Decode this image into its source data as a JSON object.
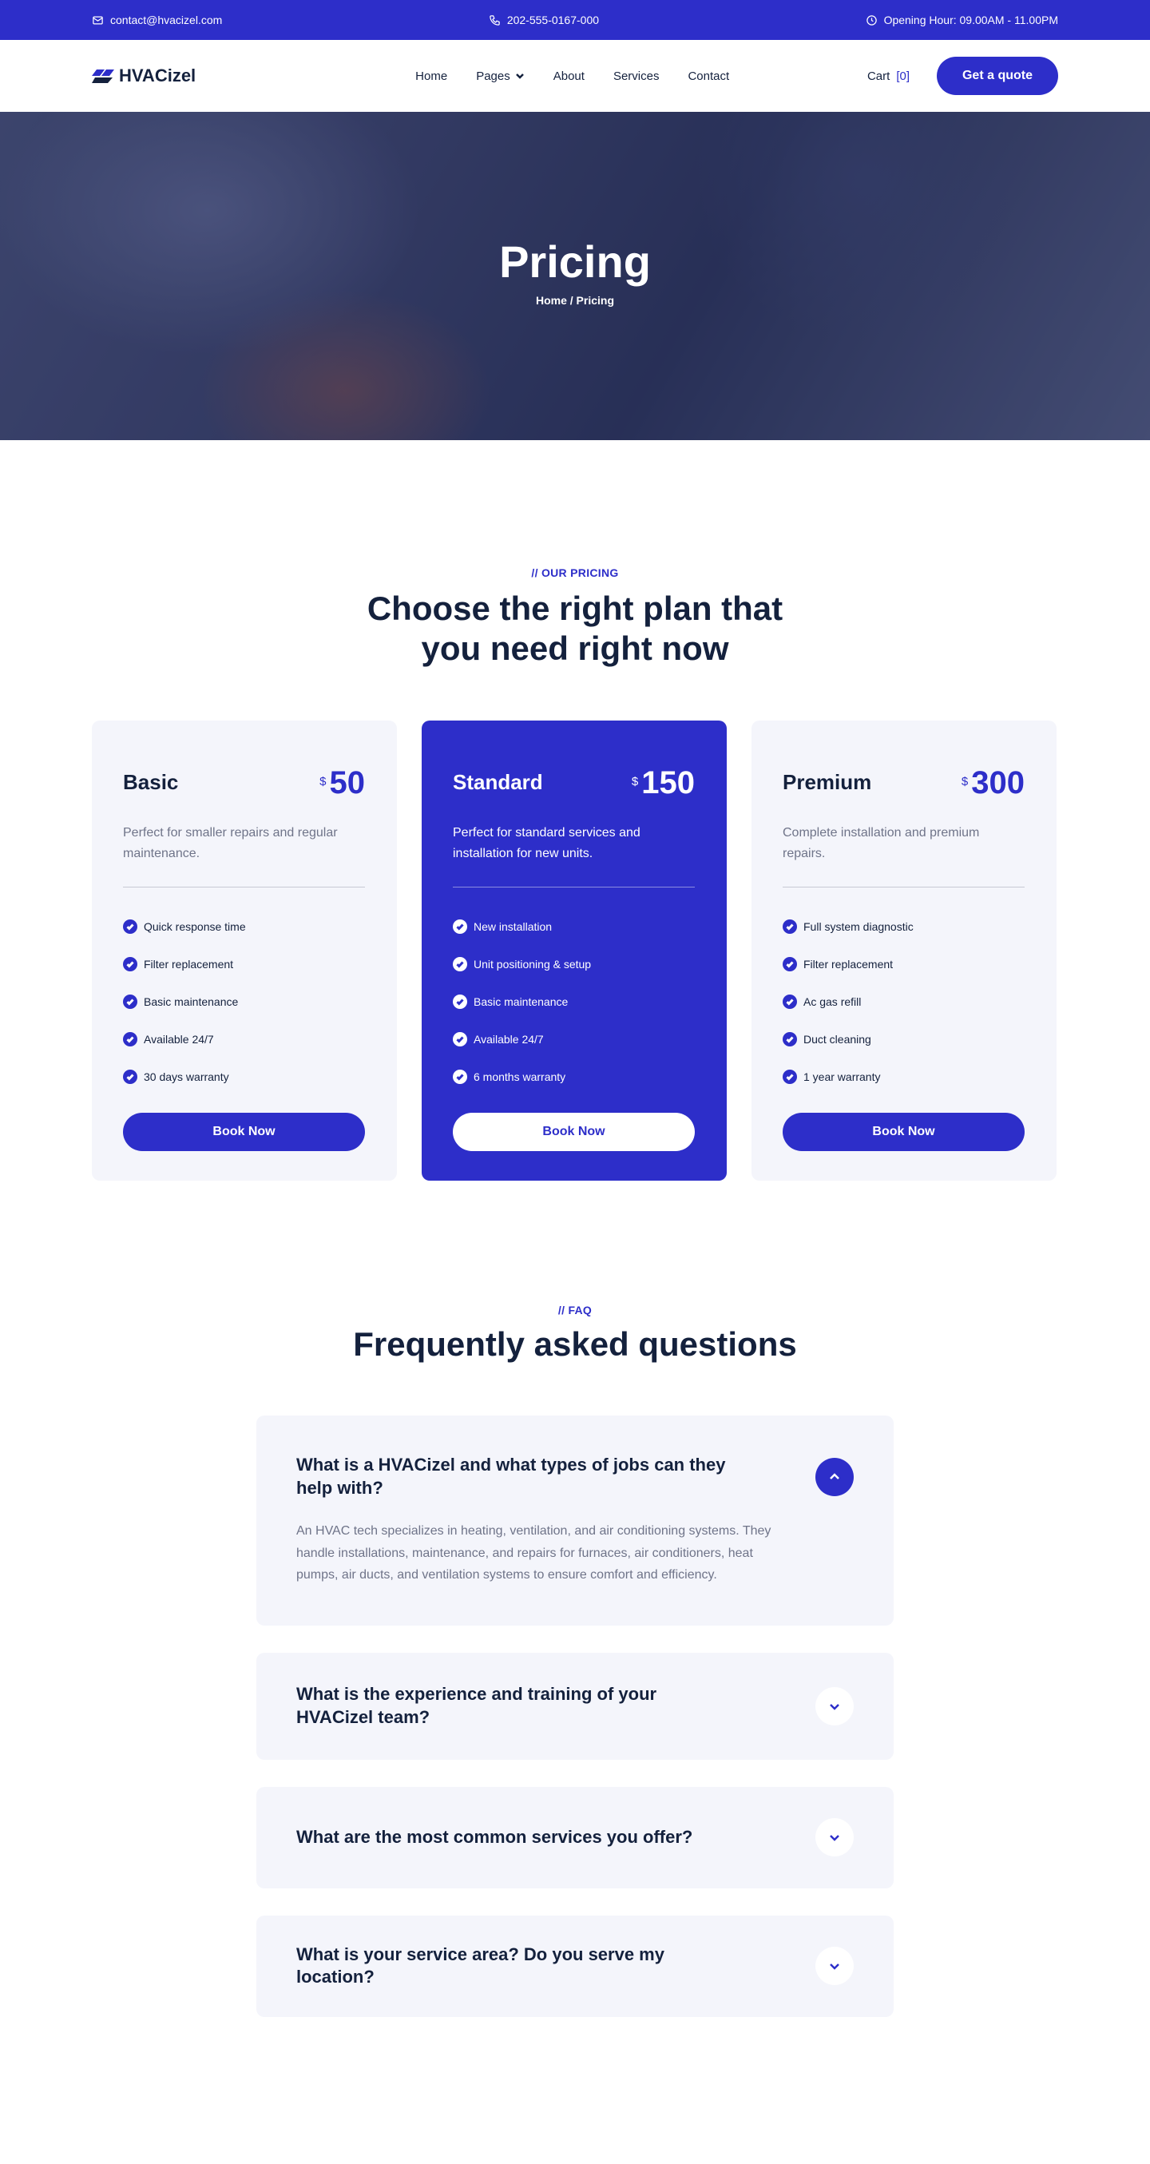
{
  "topbar": {
    "email": "contact@hvacizel.com",
    "phone": "202-555-0167-000",
    "hours": "Opening Hour: 09.00AM - 11.00PM"
  },
  "header": {
    "logo": "HVACizel",
    "nav": [
      "Home",
      "Pages",
      "About",
      "Services",
      "Contact"
    ],
    "cart_label": "Cart",
    "cart_count": "[0]",
    "cta": "Get a quote"
  },
  "hero": {
    "title": "Pricing",
    "breadcrumb": "Home / Pricing"
  },
  "pricing": {
    "eyebrow": "// OUR PRICING",
    "title_line1": "Choose the right plan that",
    "title_line2": "you need right now",
    "plans": [
      {
        "name": "Basic",
        "currency": "$",
        "amount": "50",
        "description": "Perfect for smaller repairs and regular maintenance.",
        "features": [
          "Quick response time",
          "Filter replacement",
          "Basic maintenance",
          "Available 24/7",
          "30 days warranty"
        ],
        "button": "Book Now"
      },
      {
        "name": "Standard",
        "currency": "$",
        "amount": "150",
        "description": "Perfect for standard services and installation for new units.",
        "features": [
          "New installation",
          "Unit positioning & setup",
          "Basic maintenance",
          "Available 24/7",
          "6 months warranty"
        ],
        "button": "Book Now"
      },
      {
        "name": "Premium",
        "currency": "$",
        "amount": "300",
        "description": "Complete installation and premium repairs.",
        "features": [
          "Full system diagnostic",
          "Filter replacement",
          "Ac gas refill",
          "Duct cleaning",
          "1 year warranty"
        ],
        "button": "Book Now"
      }
    ]
  },
  "faq": {
    "eyebrow": "// FAQ",
    "title": "Frequently asked questions",
    "items": [
      {
        "question": "What is a HVACizel and what types of jobs can they help with?",
        "answer": "An HVAC tech specializes in heating, ventilation, and air conditioning systems. They handle installations, maintenance, and repairs for furnaces, air conditioners, heat pumps, air ducts, and ventilation systems to ensure comfort and efficiency."
      },
      {
        "question": "What is the experience and training of your HVACizel team?"
      },
      {
        "question": "What are the most common services you offer?"
      },
      {
        "question": "What is your service area? Do you serve my location?"
      }
    ]
  },
  "colors": {
    "brand": "#2d2ec9",
    "text": "#14213d",
    "muted": "#6f7489",
    "card_bg": "#f4f5fb"
  }
}
